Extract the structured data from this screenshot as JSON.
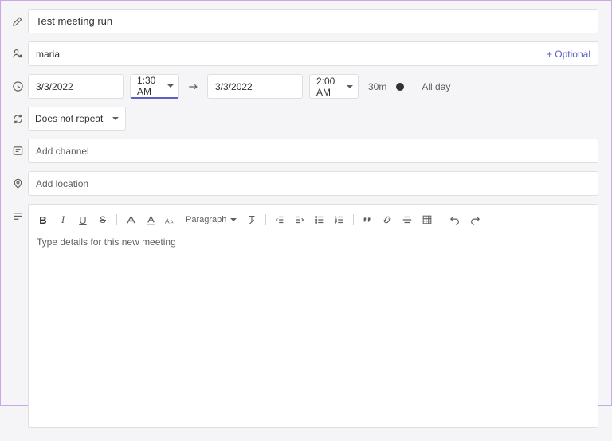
{
  "title": "Test meeting run",
  "attendees": {
    "value": "maria",
    "optional_label": "+ Optional"
  },
  "datetime": {
    "start_date": "3/3/2022",
    "start_time": "1:30 AM",
    "end_date": "3/3/2022",
    "end_time": "2:00 AM",
    "duration": "30m",
    "all_day_label": "All day"
  },
  "recurrence": {
    "value": "Does not repeat"
  },
  "channel": {
    "placeholder": "Add channel"
  },
  "location": {
    "placeholder": "Add location"
  },
  "editor": {
    "paragraph_label": "Paragraph",
    "placeholder": "Type details for this new meeting"
  }
}
